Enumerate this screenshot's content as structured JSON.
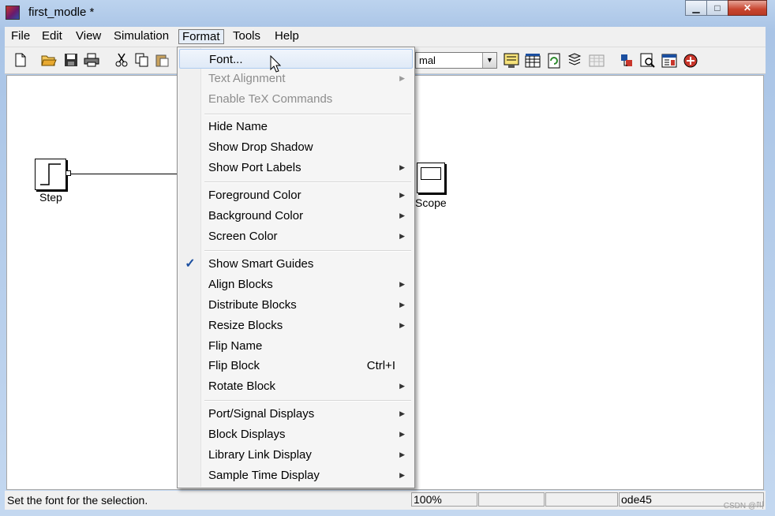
{
  "window": {
    "title": "first_modle *",
    "min_label": "▁",
    "max_label": "□",
    "close_label": "✕"
  },
  "menubar": {
    "items": [
      "File",
      "Edit",
      "View",
      "Simulation",
      "Format",
      "Tools",
      "Help"
    ],
    "active": "Format"
  },
  "toolbar": {
    "icons": [
      "new-model-icon",
      "open-icon",
      "save-icon",
      "print-icon",
      "cut-icon",
      "copy-icon",
      "paste-icon",
      "model-advisor-icon",
      "build-icon",
      "update-diagram-icon",
      "refresh-icon",
      "library-browser-icon",
      "debugger-icon",
      "model-explorer-icon",
      "sample-time-icon",
      "stop-icon"
    ],
    "sim_mode_value": "mal"
  },
  "canvas": {
    "blocks": [
      {
        "name": "Step"
      },
      {
        "name": "Scope"
      }
    ]
  },
  "format_menu": {
    "items": [
      {
        "label": "Font...",
        "submenu": false,
        "disabled": false,
        "hover": true
      },
      {
        "label": "Text Alignment",
        "submenu": true,
        "disabled": true
      },
      {
        "label": "Enable TeX Commands",
        "submenu": false,
        "disabled": true
      },
      {
        "label": "Hide Name",
        "submenu": false,
        "disabled": false
      },
      {
        "label": "Show Drop Shadow",
        "submenu": false,
        "disabled": false
      },
      {
        "label": "Show Port Labels",
        "submenu": true,
        "disabled": false
      },
      {
        "label": "Foreground Color",
        "submenu": true,
        "disabled": false
      },
      {
        "label": "Background Color",
        "submenu": true,
        "disabled": false
      },
      {
        "label": "Screen Color",
        "submenu": true,
        "disabled": false
      },
      {
        "label": "Show Smart Guides",
        "submenu": false,
        "disabled": false,
        "checked": true
      },
      {
        "label": "Align Blocks",
        "submenu": true,
        "disabled": false
      },
      {
        "label": "Distribute Blocks",
        "submenu": true,
        "disabled": false
      },
      {
        "label": "Resize Blocks",
        "submenu": true,
        "disabled": false
      },
      {
        "label": "Flip Name",
        "submenu": false,
        "disabled": false
      },
      {
        "label": "Flip Block",
        "submenu": false,
        "disabled": false,
        "shortcut": "Ctrl+I"
      },
      {
        "label": "Rotate Block",
        "submenu": true,
        "disabled": false
      },
      {
        "label": "Port/Signal Displays",
        "submenu": true,
        "disabled": false
      },
      {
        "label": "Block Displays",
        "submenu": true,
        "disabled": false
      },
      {
        "label": "Library Link Display",
        "submenu": true,
        "disabled": false
      },
      {
        "label": "Sample Time Display",
        "submenu": true,
        "disabled": false
      }
    ]
  },
  "statusbar": {
    "message": "Set the font for the selection.",
    "zoom": "100%",
    "cell2": "",
    "cell3": "",
    "solver": "ode45"
  },
  "watermark": "CSDN @叫"
}
